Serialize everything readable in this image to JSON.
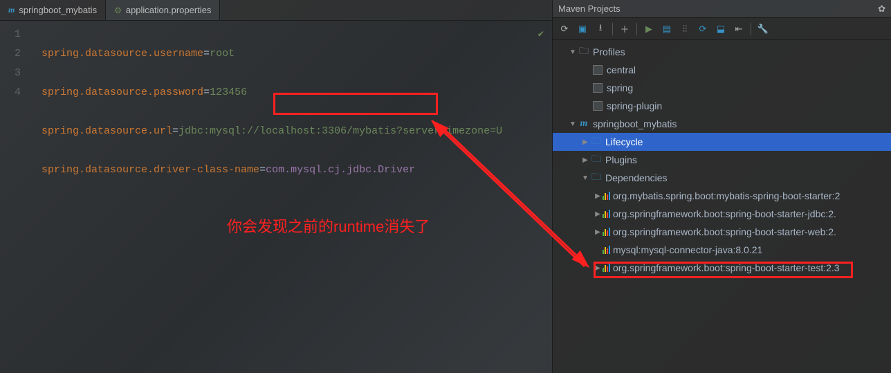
{
  "tabs": [
    {
      "label": "springboot_mybatis",
      "icon": "m",
      "active": false
    },
    {
      "label": "application.properties",
      "icon": "gear",
      "active": true
    }
  ],
  "code": {
    "lines": [
      {
        "n": "1",
        "pre": "spring.datasource.username",
        "eq": "=",
        "val": "root"
      },
      {
        "n": "2",
        "pre": "spring.datasource.password",
        "eq": "=",
        "val": "123456"
      },
      {
        "n": "3",
        "pre": "spring.datasource.url",
        "eq": "=",
        "val": "jdbc:mysql://localhost:3306/mybatis?serverTimezone=U"
      },
      {
        "n": "4",
        "pre": "spring.datasource.driver-class-name",
        "eq": "=",
        "val": "com.mysql.cj.jdbc.Driver"
      }
    ]
  },
  "annotation": "你会发现之前的runtime消失了",
  "maven": {
    "title": "Maven Projects",
    "profiles_label": "Profiles",
    "profiles": [
      "central",
      "spring",
      "spring-plugin"
    ],
    "project": "springboot_mybatis",
    "lifecycle": "Lifecycle",
    "plugins": "Plugins",
    "dependencies_label": "Dependencies",
    "dependencies": [
      "org.mybatis.spring.boot:mybatis-spring-boot-starter:2",
      "org.springframework.boot:spring-boot-starter-jdbc:2.",
      "org.springframework.boot:spring-boot-starter-web:2.",
      "mysql:mysql-connector-java:8.0.21",
      "org.springframework.boot:spring-boot-starter-test:2.3"
    ]
  }
}
